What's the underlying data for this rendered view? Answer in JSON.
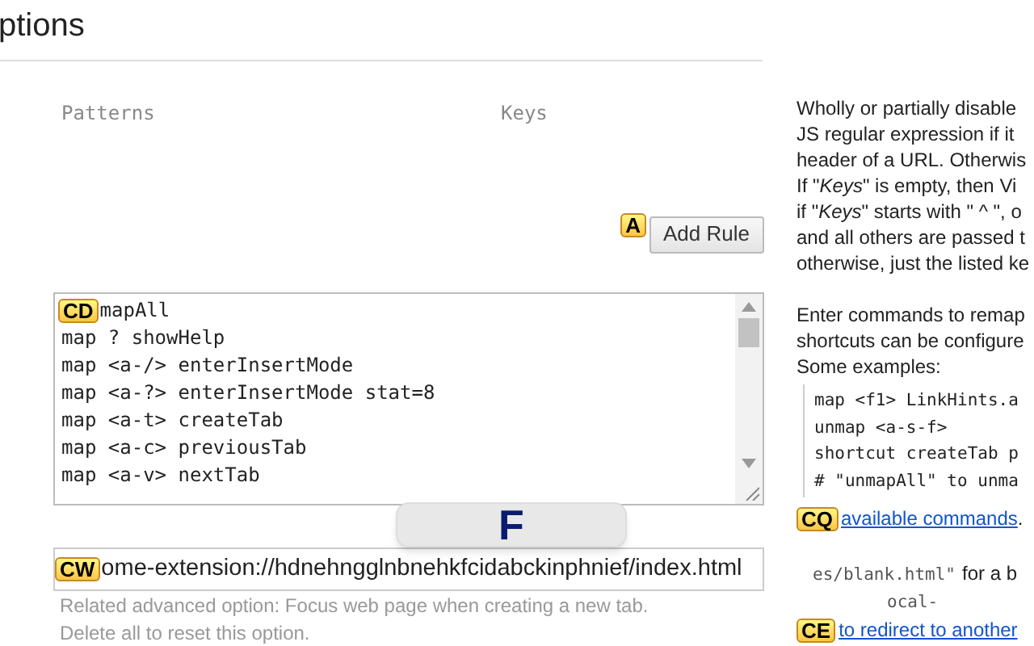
{
  "page_title": "ptions",
  "exclusions": {
    "columns": [
      "Patterns",
      "Keys"
    ],
    "add_button": "Add Rule"
  },
  "key_mappings": {
    "lines": [
      "mapAll",
      "map ? showHelp",
      "map <a-/> enterInsertMode",
      "map <a-?> enterInsertMode stat=8",
      "map <a-t> createTab",
      "map <a-c> previousTab",
      "map <a-v> nextTab"
    ]
  },
  "new_tab_url": {
    "value": "ome-extension://hdnehngglnbnehkfcidabckinphnief/index.html",
    "note": "Related advanced option: Focus web page when creating a new tab.",
    "note_2": "Delete all to reset this option."
  },
  "help": {
    "exclusion_lines": [
      "Wholly or partially disable",
      "JS regular expression if it",
      "header of a URL. Otherwis",
      "If \"*Keys*\" is empty, then Vi",
      "if \"*Keys*\" starts with \" ^ \", o",
      "and all others are passed t",
      "otherwise, just the listed ke"
    ],
    "mapping_lines": [
      "Enter commands to remap",
      "shortcuts can be configure",
      "Some examples:"
    ],
    "examples": [
      "map <f1> LinkHints.a",
      "unmap <a-s-f>",
      "shortcut createTab p",
      "# \"unmapAll\" to unma"
    ],
    "commands_link": "available commands",
    "commands_link_end": ".",
    "url_code": "es/blank.html\"",
    "url_text": "for a b",
    "url_code_2": "ocal-",
    "redirect_link": "to redirect to another"
  },
  "hints": [
    "A",
    "CD",
    "CW",
    "CQ",
    "CE"
  ],
  "key_display": "F"
}
